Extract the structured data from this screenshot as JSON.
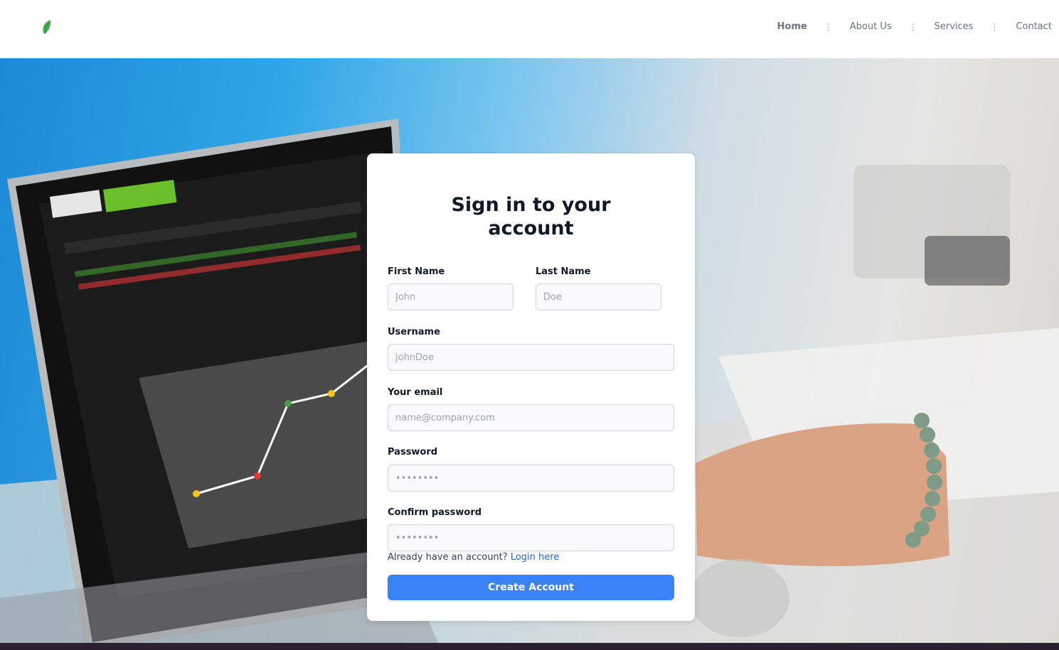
{
  "nav": {
    "items": [
      {
        "label": "Home",
        "active": true
      },
      {
        "label": "About Us"
      },
      {
        "label": "Services"
      },
      {
        "label": "Contact"
      }
    ],
    "separator": "⋮"
  },
  "form": {
    "title": "Sign in to your account",
    "first_name": {
      "label": "First Name",
      "placeholder": "John"
    },
    "last_name": {
      "label": "Last Name",
      "placeholder": "Doe"
    },
    "username": {
      "label": "Username",
      "placeholder": "johnDoe"
    },
    "email": {
      "label": "Your email",
      "placeholder": "name@company.com"
    },
    "password": {
      "label": "Password",
      "placeholder": "••••••••"
    },
    "confirm_password": {
      "label": "Confirm password",
      "placeholder": "••••••••"
    },
    "login_prompt": "Already have an account?",
    "login_link": "Login here",
    "submit_label": "Create Account"
  },
  "colors": {
    "accent": "#3b82f6",
    "link": "#2563eb",
    "logo_green": "#4caf50"
  }
}
